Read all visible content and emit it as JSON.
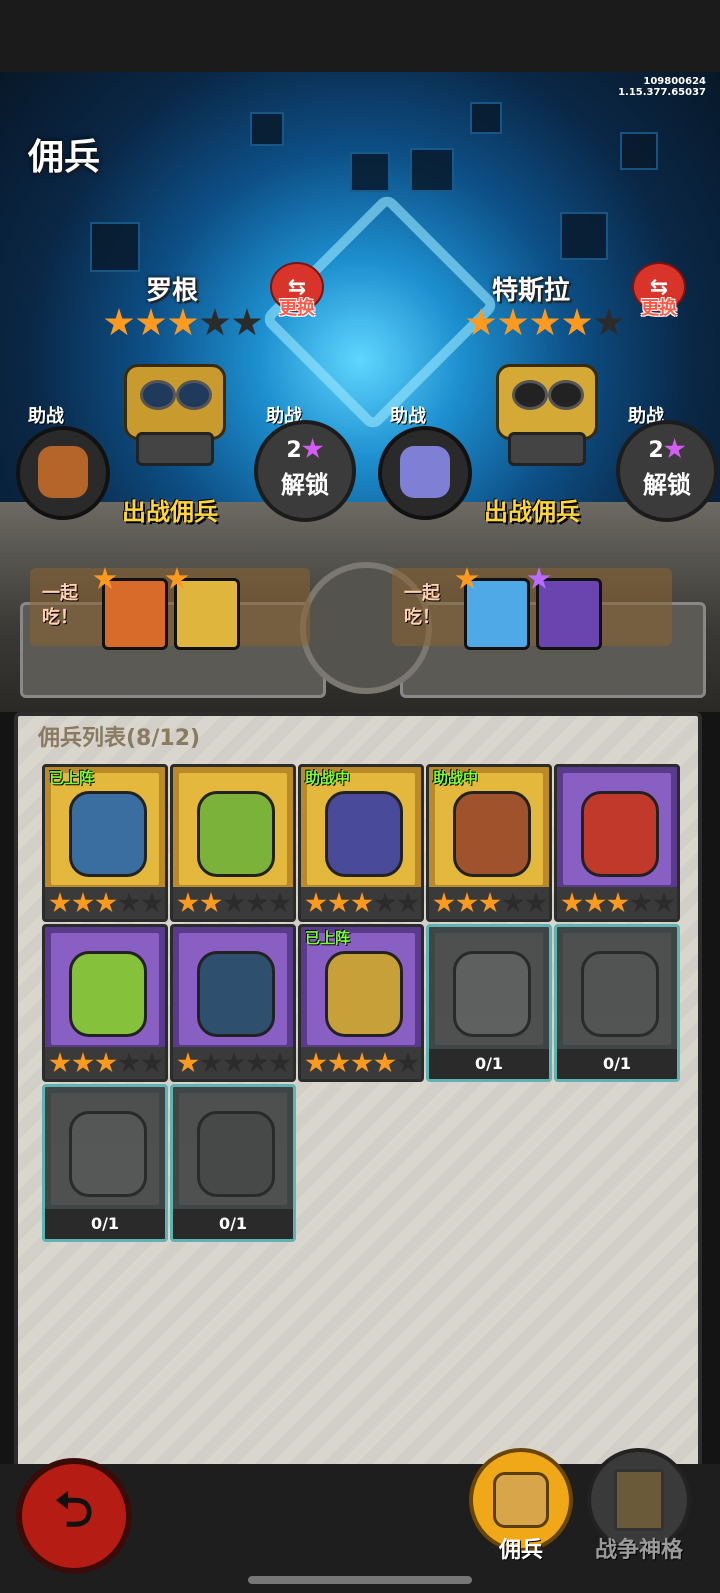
{
  "version": {
    "line1": "109800624",
    "line2": "1.15.377.65037"
  },
  "page_title": "佣兵",
  "slots": [
    {
      "name": "罗根",
      "stars": 3,
      "max_stars": 5,
      "swap_label": "更换",
      "deploy_label": "出战佣兵",
      "assist_label_left": "助战",
      "assist_label_right": "助战",
      "unlock_count": "2",
      "unlock_label": "解锁",
      "eat_label": "一起吃！"
    },
    {
      "name": "特斯拉",
      "stars": 4,
      "max_stars": 5,
      "swap_label": "更换",
      "deploy_label": "出战佣兵",
      "assist_label_left": "助战",
      "assist_label_right": "助战",
      "unlock_count": "2",
      "unlock_label": "解锁",
      "eat_label": "一起吃！"
    }
  ],
  "list": {
    "title": "佣兵列表(8/12)",
    "cards": [
      {
        "tag": "已上阵",
        "frame": "gold",
        "stars": 3
      },
      {
        "tag": "",
        "frame": "gold",
        "stars": 2
      },
      {
        "tag": "助战中",
        "frame": "gold",
        "stars": 3
      },
      {
        "tag": "助战中",
        "frame": "gold",
        "stars": 3
      },
      {
        "tag": "",
        "frame": "purple",
        "stars": 3
      },
      {
        "tag": "",
        "frame": "purple",
        "stars": 3
      },
      {
        "tag": "",
        "frame": "purple",
        "stars": 1
      },
      {
        "tag": "已上阵",
        "frame": "purple",
        "stars": 4
      },
      {
        "tag": "",
        "frame": "locked",
        "progress": "0/1"
      },
      {
        "tag": "",
        "frame": "locked",
        "progress": "0/1"
      },
      {
        "tag": "",
        "frame": "locked",
        "progress": "0/1"
      },
      {
        "tag": "",
        "frame": "locked",
        "progress": "0/1"
      }
    ]
  },
  "nav": {
    "mercenary_label": "佣兵",
    "artifact_label": "战争神格"
  },
  "colors": {
    "star_on": "#ff9a1f",
    "star_off": "#2b2b2b",
    "tag_green": "#7dff3a",
    "back_red": "#b51c14"
  }
}
